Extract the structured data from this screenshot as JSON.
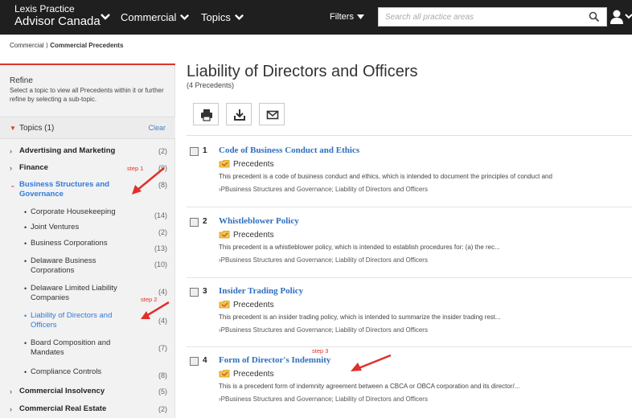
{
  "header": {
    "brand_line1": "Lexis Practice",
    "brand_line2": "Advisor Canada",
    "nav_commercial": "Commercial",
    "nav_topics": "Topics",
    "filters_label": "Filters",
    "search_placeholder": "Search all practice areas"
  },
  "breadcrumb": {
    "root": "Commercial",
    "sep": "⟩",
    "current": "Commercial Precedents"
  },
  "sidebar": {
    "refine_title": "Refine",
    "refine_desc": "Select a topic to view all Precedents within it or further refine by selecting a sub-topic.",
    "topics_label": "Topics (1)",
    "clear_label": "Clear",
    "items": [
      {
        "name": "Advertising and Marketing",
        "count": "(2)"
      },
      {
        "name": "Finance",
        "count": "(9)"
      },
      {
        "name": "Business Structures and Governance",
        "count": "(8)"
      },
      {
        "name": "Corporate Housekeeping",
        "count": "(14)"
      },
      {
        "name": "Joint Ventures",
        "count": "(2)"
      },
      {
        "name": "Business Corporations",
        "count": "(13)"
      },
      {
        "name": "Delaware Business Corporations",
        "count": "(10)"
      },
      {
        "name": "Delaware Limited Liability Companies",
        "count": "(4)"
      },
      {
        "name": "Liability of Directors and Officers",
        "count": "(4)"
      },
      {
        "name": "Board Composition and Mandates",
        "count": "(7)"
      },
      {
        "name": "Compliance Controls",
        "count": "(8)"
      },
      {
        "name": "Commercial Insolvency",
        "count": "(5)"
      },
      {
        "name": "Commercial Real Estate",
        "count": "(2)"
      }
    ]
  },
  "annotations": {
    "step1": "step 1",
    "step2": "step 2",
    "step3": "step 3"
  },
  "main": {
    "title": "Liability of Directors and Officers",
    "count": "(4 Precedents)",
    "results": [
      {
        "num": "1",
        "title": "Code of Business Conduct and Ethics",
        "type": "Precedents",
        "desc": "This precedent is a code of business conduct and ethics, which is intended to document the principles of conduct and",
        "path": "›PBusiness Structures and Governance; Liability of Directors and Officers"
      },
      {
        "num": "2",
        "title": "Whistleblower Policy",
        "type": "Precedents",
        "desc": "This precedent is a whistleblower policy, which is intended to establish procedures for: (a) the rec...",
        "path": "›PBusiness Structures and Governance; Liability of Directors and Officers"
      },
      {
        "num": "3",
        "title": "Insider Trading Policy",
        "type": "Precedents",
        "desc": "This precedent is an insider trading policy, which is intended to summarize the insider trading rest...",
        "path": "›PBusiness Structures and Governance; Liability of Directors and Officers"
      },
      {
        "num": "4",
        "title": "Form of Director's Indemnity",
        "type": "Precedents",
        "desc": "This is a precedent form of indemnity agreement between a CBCA or OBCA corporation and its director/...",
        "path": "›PBusiness Structures and Governance; Liability of Directors and Officers"
      }
    ]
  },
  "colors": {
    "accent_red": "#d9372b",
    "link_blue": "#2f6fbf",
    "header_bg": "#1f1f1f"
  }
}
